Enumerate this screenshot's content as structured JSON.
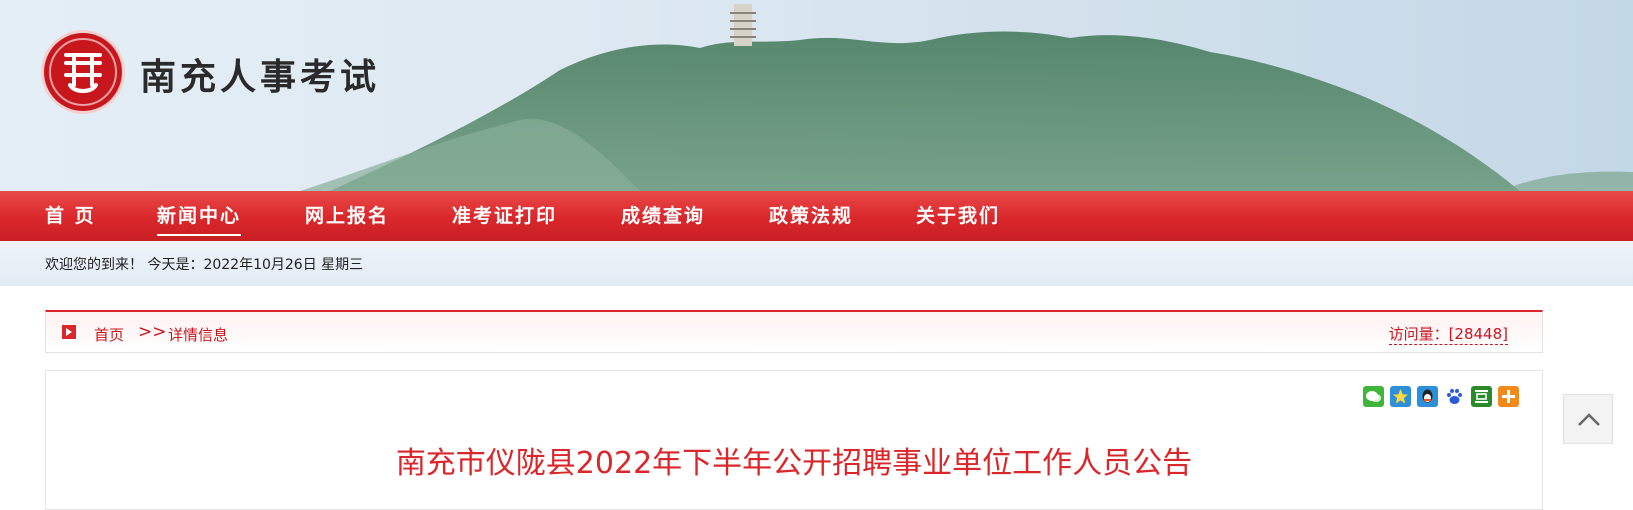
{
  "site": {
    "title": "南充人事考试"
  },
  "nav": {
    "items": [
      {
        "label": "首 页"
      },
      {
        "label": "新闻中心"
      },
      {
        "label": "网上报名"
      },
      {
        "label": "准考证打印"
      },
      {
        "label": "成绩查询"
      },
      {
        "label": "政策法规"
      },
      {
        "label": "关于我们"
      }
    ],
    "active_index": 1
  },
  "welcome": {
    "text": "欢迎您的到来！ 今天是：2022年10月26日 星期三"
  },
  "breadcrumb": {
    "home": "首页",
    "separator": ">>",
    "current": "详情信息",
    "visits": "访问量：[28448]"
  },
  "share": {
    "icons": [
      "wechat-icon",
      "qzone-icon",
      "qq-icon",
      "baidu-icon",
      "douban-icon",
      "more-share-icon"
    ]
  },
  "article": {
    "title": "南充市仪陇县2022年下半年公开招聘事业单位工作人员公告"
  },
  "colors": {
    "brand_red": "#d9272b",
    "title_red": "#d9272b"
  }
}
